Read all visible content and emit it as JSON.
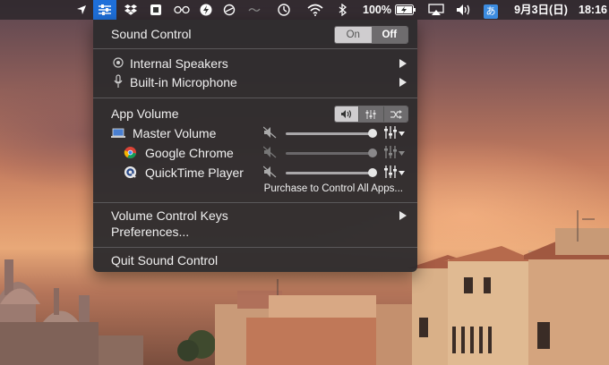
{
  "menubar": {
    "wifi_battery": "100%",
    "date": "9月3日(日)",
    "time": "18:16",
    "input_method": "あ"
  },
  "menu": {
    "title": "Sound Control",
    "toggle": {
      "on_label": "On",
      "off_label": "Off",
      "selected": "Off"
    },
    "outputs": [
      {
        "label": "Internal Speakers",
        "icon": "speaker-icon"
      },
      {
        "label": "Built-in Microphone",
        "icon": "microphone-icon"
      }
    ],
    "app_volume_label": "App Volume",
    "apps": [
      {
        "label": "Master Volume",
        "icon": "laptop-icon",
        "level": 1.0,
        "enabled": true
      },
      {
        "label": "Google Chrome",
        "icon": "chrome-icon",
        "level": 1.0,
        "enabled": false
      },
      {
        "label": "QuickTime Player",
        "icon": "quicktime-icon",
        "level": 1.0,
        "enabled": true
      }
    ],
    "purchase_label": "Purchase to Control All Apps...",
    "volume_keys_label": "Volume Control Keys",
    "preferences_label": "Preferences...",
    "quit_label": "Quit Sound Control"
  }
}
